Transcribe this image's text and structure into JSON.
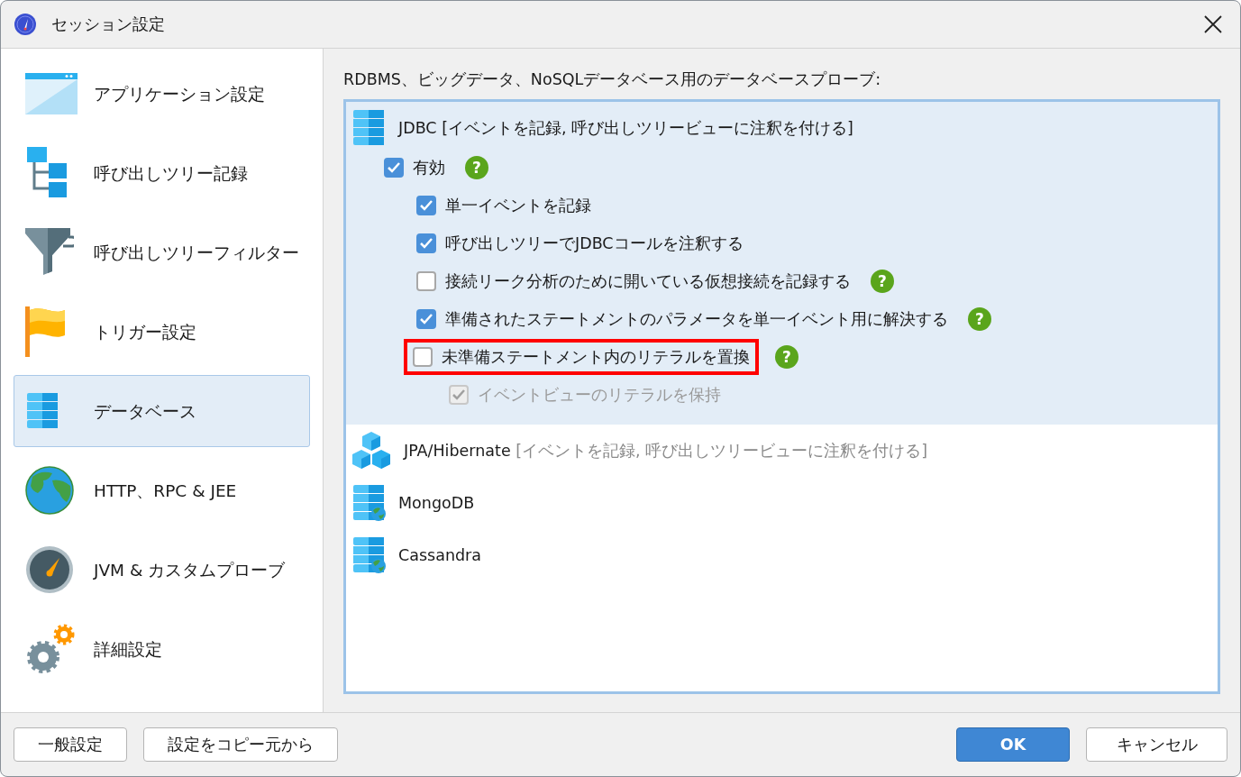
{
  "window": {
    "title": "セッション設定"
  },
  "sidebar": {
    "items": [
      {
        "label": "アプリケーション設定",
        "kind": "window",
        "selected": false
      },
      {
        "label": "呼び出しツリー記録",
        "kind": "tree",
        "selected": false
      },
      {
        "label": "呼び出しツリーフィルター",
        "kind": "funnel",
        "selected": false
      },
      {
        "label": "トリガー設定",
        "kind": "flag",
        "selected": false
      },
      {
        "label": "データベース",
        "kind": "database",
        "selected": true
      },
      {
        "label": "HTTP、RPC & JEE",
        "kind": "globe",
        "selected": false
      },
      {
        "label": "JVM & カスタムプローブ",
        "kind": "gauge",
        "selected": false
      },
      {
        "label": "詳細設定",
        "kind": "gears",
        "selected": false
      }
    ]
  },
  "section_label": "RDBMS、ビッグデータ、NoSQLデータベース用のデータベースプローブ:",
  "probes": [
    {
      "name": "JDBC",
      "description": "[イベントを記録, 呼び出しツリービューに注釈を付ける]",
      "kind": "database",
      "active": true,
      "selected": true,
      "options": [
        {
          "label": "有効",
          "checked": true,
          "disabled": false,
          "help": "?",
          "highlighted": false,
          "children": [
            {
              "label": "単一イベントを記録",
              "checked": true,
              "disabled": false,
              "highlighted": false
            },
            {
              "label": "呼び出しツリーでJDBCコールを注釈する",
              "checked": true,
              "disabled": false,
              "highlighted": false
            },
            {
              "label": "接続リーク分析のために開いている仮想接続を記録する",
              "checked": false,
              "disabled": false,
              "help": "?",
              "highlighted": false
            },
            {
              "label": "準備されたステートメントのパラメータを単一イベント用に解決する",
              "checked": true,
              "disabled": false,
              "help": "?",
              "highlighted": false
            },
            {
              "label": "未準備ステートメント内のリテラルを置換",
              "checked": false,
              "disabled": false,
              "help": "?",
              "highlighted": true,
              "children": [
                {
                  "label": "イベントビューのリテラルを保持",
                  "checked": true,
                  "disabled": true,
                  "highlighted": false
                }
              ]
            }
          ]
        }
      ]
    },
    {
      "name": "JPA/Hibernate",
      "description": "[イベントを記録, 呼び出しツリービューに注釈を付ける]",
      "kind": "cubes",
      "active": false,
      "selected": false
    },
    {
      "name": "MongoDB",
      "kind": "database-globe",
      "selected": false
    },
    {
      "name": "Cassandra",
      "kind": "database-globe",
      "selected": false
    }
  ],
  "footer": {
    "left_buttons": [
      "一般設定",
      "設定をコピー元から"
    ],
    "ok": "OK",
    "cancel": "キャンセル"
  }
}
